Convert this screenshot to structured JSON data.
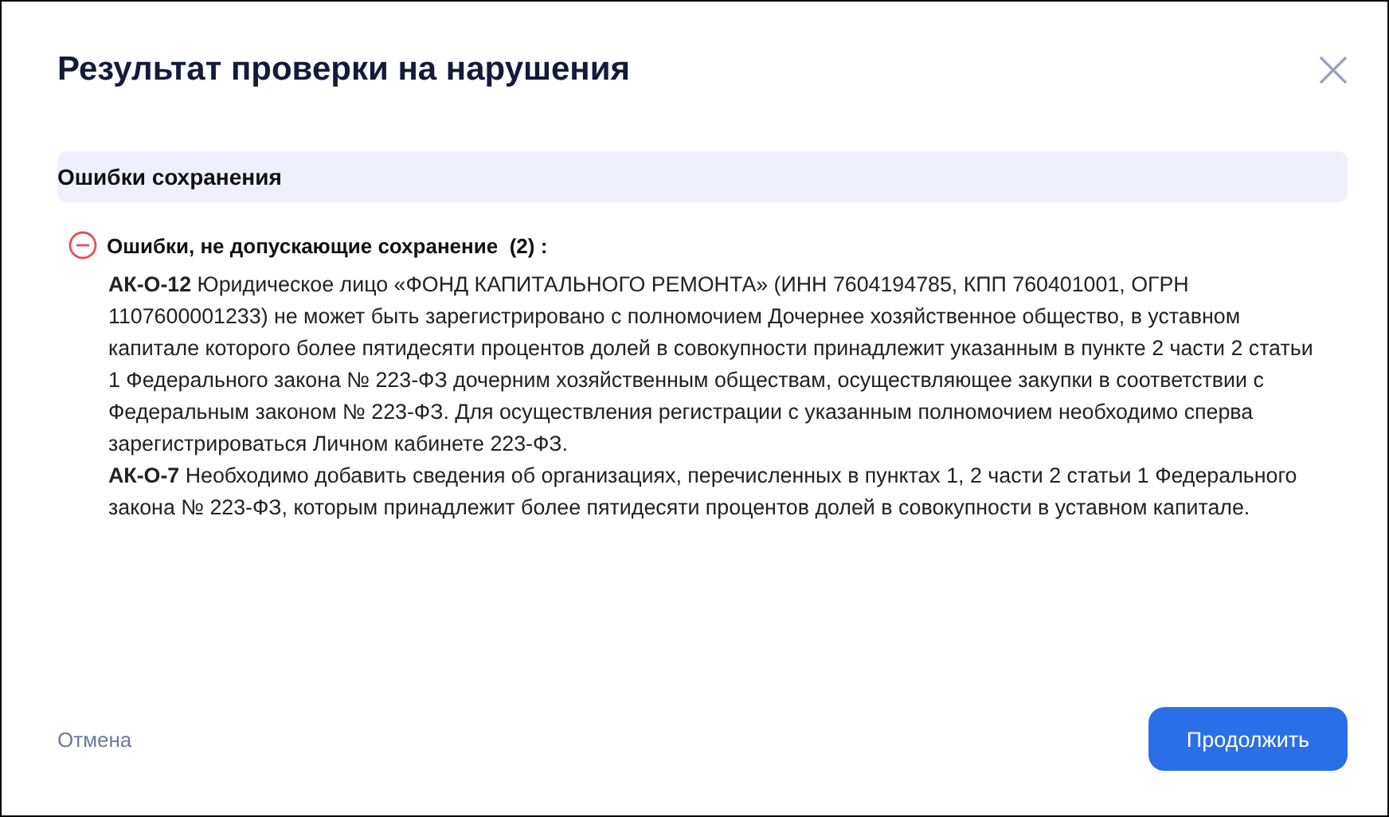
{
  "dialog": {
    "title": "Результат проверки на нарушения"
  },
  "section": {
    "title": "Ошибки сохранения",
    "group": {
      "label": "Ошибки, не допускающие сохранение  (2) :",
      "expanded": true,
      "errors": [
        {
          "text": "**АК-О-12** Юридическое лицо «ФОНД КАПИТАЛЬНОГО РЕМОНТА» (ИНН 7604194785, КПП 760401001, ОГРН 1107600001233) не может быть зарегистрировано с полномочием Дочернее хозяйственное общество, в уставном капитале которого более пятидесяти процентов долей в совокупности принадлежит указанным в пункте 2 части 2 статьи 1 Федерального закона № 223-ФЗ дочерним хозяйственным обществам, осуществляющее закупки в соответствии с Федеральным законом № 223-ФЗ. Для осуществления регистрации с указанным полномочием необходимо сперва зарегистрироваться Личном кабинете 223-ФЗ."
        },
        {
          "text": "**АК-О-7** Необходимо добавить сведения об организациях, перечисленных в пунктах 1, 2 части 2 статьи 1 Федерального закона № 223-ФЗ, которым принадлежит более пятидесяти процентов долей в совокупности в уставном капитале."
        }
      ]
    }
  },
  "buttons": {
    "cancel": "Отмена",
    "continue": "Продолжить"
  }
}
